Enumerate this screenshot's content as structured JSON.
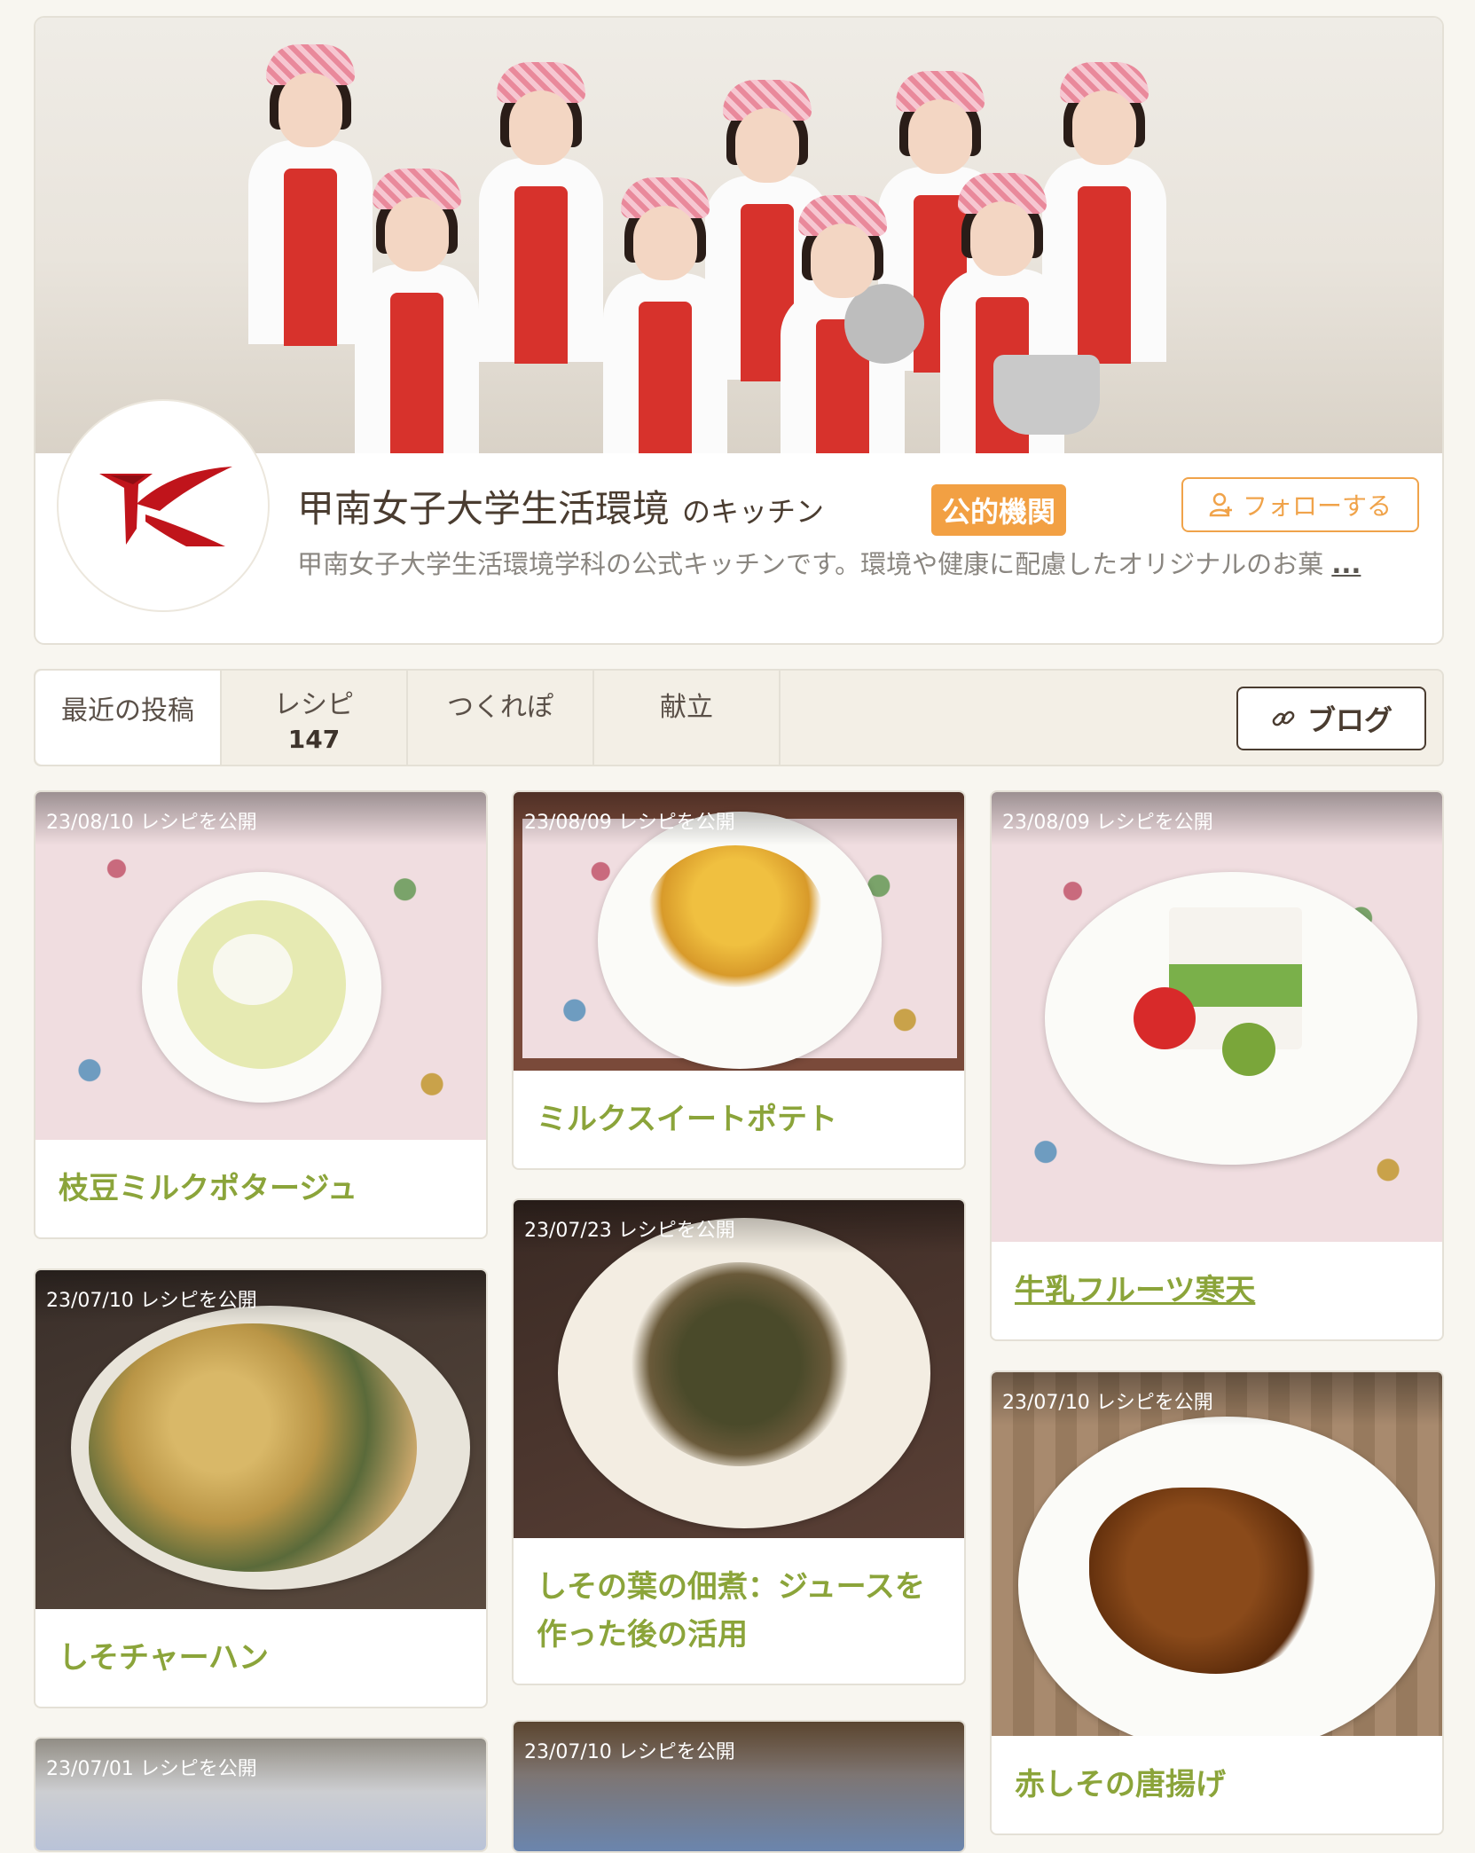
{
  "kitchen": {
    "name": "甲南女子大学生活環境",
    "suffix": "のキッチン",
    "badge": "公的機関",
    "follow_label": "フォローする",
    "description": "甲南女子大学生活環境学科の公式キッチンです。環境や健康に配慮したオリジナルのお菓",
    "more": "..."
  },
  "tabs": [
    {
      "label": "最近の投稿",
      "count": ""
    },
    {
      "label": "レシピ",
      "count": "147"
    },
    {
      "label": "つくれぽ",
      "count": ""
    },
    {
      "label": "献立",
      "count": ""
    }
  ],
  "blog_label": "ブログ",
  "recipes": [
    {
      "date": "23/08/10 レシピを公開",
      "title": "枝豆ミルクポタージュ"
    },
    {
      "date": "23/08/09 レシピを公開",
      "title": "ミルクスイートポテト"
    },
    {
      "date": "23/08/09 レシピを公開",
      "title": "牛乳フルーツ寒天"
    },
    {
      "date": "23/07/10 レシピを公開",
      "title": "しそチャーハン"
    },
    {
      "date": "23/07/23 レシピを公開",
      "title": "しその葉の佃煮：ジュースを作った後の活用"
    },
    {
      "date": "23/07/10 レシピを公開",
      "title": "赤しその唐揚げ"
    },
    {
      "date": "23/07/01 レシピを公開",
      "title": ""
    },
    {
      "date": "23/07/10 レシピを公開",
      "title": ""
    }
  ]
}
